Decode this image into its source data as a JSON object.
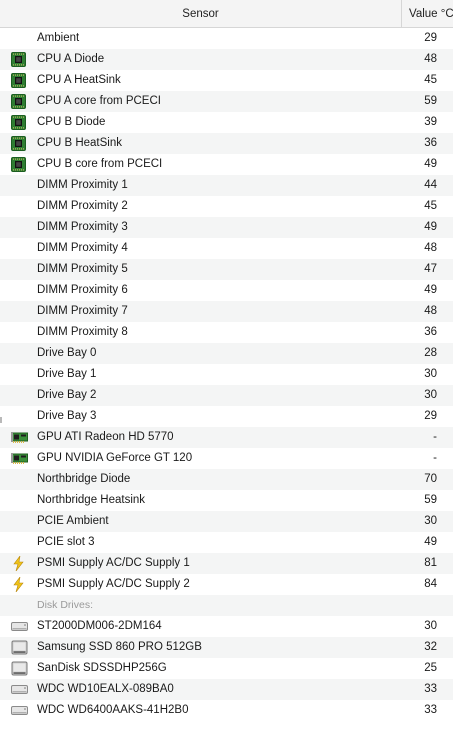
{
  "header": {
    "sensor": "Sensor",
    "value": "Value °C"
  },
  "rows": [
    {
      "name": "Ambient",
      "value": "29",
      "icon": "none"
    },
    {
      "name": "CPU A Diode",
      "value": "48",
      "icon": "chip-icon"
    },
    {
      "name": "CPU A HeatSink",
      "value": "45",
      "icon": "chip-icon"
    },
    {
      "name": "CPU A core from PCECI",
      "value": "59",
      "icon": "chip-icon"
    },
    {
      "name": "CPU B Diode",
      "value": "39",
      "icon": "chip-icon"
    },
    {
      "name": "CPU B HeatSink",
      "value": "36",
      "icon": "chip-icon"
    },
    {
      "name": "CPU B core from PCECI",
      "value": "49",
      "icon": "chip-icon"
    },
    {
      "name": "DIMM Proximity 1",
      "value": "44",
      "icon": "none"
    },
    {
      "name": "DIMM Proximity 2",
      "value": "45",
      "icon": "none"
    },
    {
      "name": "DIMM Proximity 3",
      "value": "49",
      "icon": "none"
    },
    {
      "name": "DIMM Proximity 4",
      "value": "48",
      "icon": "none"
    },
    {
      "name": "DIMM Proximity 5",
      "value": "47",
      "icon": "none"
    },
    {
      "name": "DIMM Proximity 6",
      "value": "49",
      "icon": "none"
    },
    {
      "name": "DIMM Proximity 7",
      "value": "48",
      "icon": "none"
    },
    {
      "name": "DIMM Proximity 8",
      "value": "36",
      "icon": "none"
    },
    {
      "name": "Drive Bay 0",
      "value": "28",
      "icon": "none"
    },
    {
      "name": "Drive Bay 1",
      "value": "30",
      "icon": "none"
    },
    {
      "name": "Drive Bay 2",
      "value": "30",
      "icon": "none"
    },
    {
      "name": "Drive Bay 3",
      "value": "29",
      "icon": "none"
    },
    {
      "name": "GPU ATI Radeon HD 5770",
      "value": "-",
      "icon": "gpu-card-icon"
    },
    {
      "name": "GPU NVIDIA GeForce GT 120",
      "value": "-",
      "icon": "gpu-card-icon"
    },
    {
      "name": "Northbridge Diode",
      "value": "70",
      "icon": "none"
    },
    {
      "name": "Northbridge Heatsink",
      "value": "59",
      "icon": "none"
    },
    {
      "name": "PCIE Ambient",
      "value": "30",
      "icon": "none"
    },
    {
      "name": "PCIE slot 3",
      "value": "49",
      "icon": "none"
    },
    {
      "name": "PSMI Supply AC/DC Supply 1",
      "value": "81",
      "icon": "lightning-icon"
    },
    {
      "name": "PSMI Supply AC/DC Supply 2",
      "value": "84",
      "icon": "lightning-icon"
    },
    {
      "name": "Disk Drives:",
      "value": "",
      "icon": "none",
      "section": true
    },
    {
      "name": "ST2000DM006-2DM164",
      "value": "30",
      "icon": "hard-drive-icon"
    },
    {
      "name": "Samsung SSD 860 PRO 512GB",
      "value": "32",
      "icon": "ssd-icon"
    },
    {
      "name": "SanDisk SDSSDHP256G",
      "value": "25",
      "icon": "ssd-icon"
    },
    {
      "name": "WDC WD10EALX-089BA0",
      "value": "33",
      "icon": "hard-drive-icon"
    },
    {
      "name": "WDC WD6400AAKS-41H2B0",
      "value": "33",
      "icon": "hard-drive-icon"
    }
  ]
}
